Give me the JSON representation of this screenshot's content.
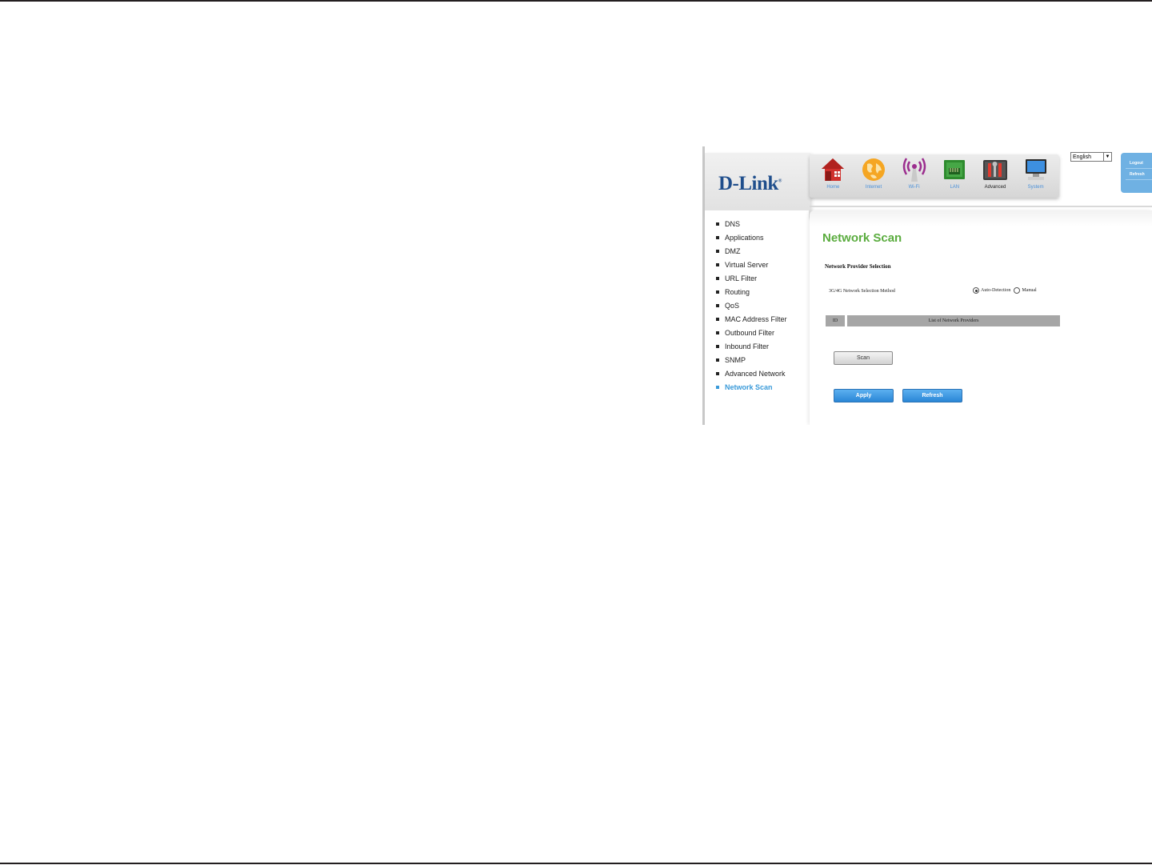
{
  "brand": {
    "logo": "D-Link",
    "trademark": "®"
  },
  "nav": {
    "items": [
      {
        "label": "Home",
        "icon": "home-icon"
      },
      {
        "label": "Internet",
        "icon": "globe-icon"
      },
      {
        "label": "Wi-Fi",
        "icon": "wifi-icon"
      },
      {
        "label": "LAN",
        "icon": "lan-icon"
      },
      {
        "label": "Advanced",
        "icon": "tools-icon"
      },
      {
        "label": "System",
        "icon": "monitor-icon"
      }
    ],
    "active": "Advanced"
  },
  "language": {
    "selected": "English"
  },
  "user_panel": {
    "logout": "Logout",
    "refresh": "Refresh"
  },
  "sidebar": {
    "items": [
      "DNS",
      "Applications",
      "DMZ",
      "Virtual Server",
      "URL Filter",
      "Routing",
      "QoS",
      "MAC Address Filter",
      "Outbound Filter",
      "Inbound Filter",
      "SNMP",
      "Advanced Network",
      "Network Scan"
    ],
    "active": "Network Scan"
  },
  "main": {
    "title": "Network Scan",
    "section_title": "Network Provider Selection",
    "method_label": "3G/4G Network Selection Method",
    "radio_auto": "Auto-Detection",
    "radio_manual": "Manual",
    "table": {
      "col_id": "ID",
      "col_list": "List of Network Providers"
    },
    "scan_label": "Scan",
    "apply_label": "Apply",
    "refresh_label": "Refresh"
  },
  "colors": {
    "title_green": "#5aac3e",
    "active_blue": "#3a9ad9",
    "brand_blue": "#1f4e8c"
  }
}
